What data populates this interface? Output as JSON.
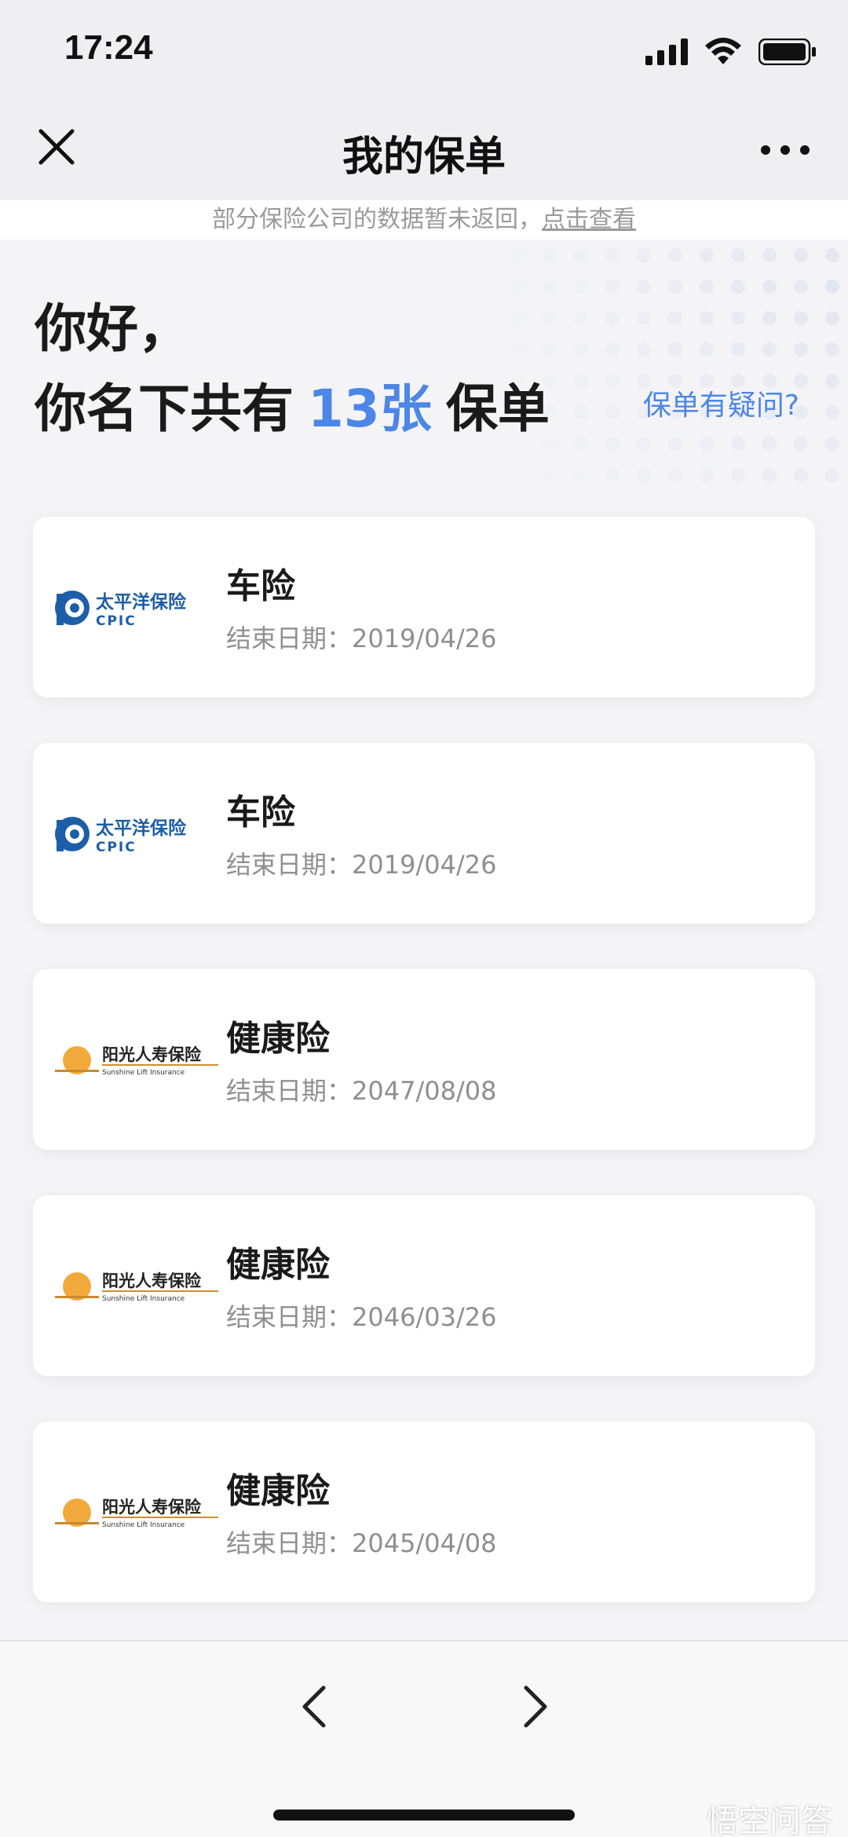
{
  "status_bar": {
    "time": "17:24",
    "icons": [
      "signal-icon",
      "wifi-icon",
      "battery-icon"
    ]
  },
  "nav": {
    "title": "我的保单",
    "close_icon": "close-icon",
    "more_icon": "more-icon"
  },
  "notice": {
    "text": "部分保险公司的数据暂未返回，",
    "link": "点击查看"
  },
  "greeting": {
    "hello": "你好，",
    "prefix": "你名下共有",
    "count": "13张",
    "suffix": "保单",
    "question_link": "保单有疑问?"
  },
  "policies": [
    {
      "title": "车险",
      "date_label": "结束日期：",
      "date": "2019/04/26",
      "insurer": "太平洋保险",
      "insurer_en": "CPIC"
    },
    {
      "title": "车险",
      "date_label": "结束日期：",
      "date": "2019/04/26",
      "insurer": "太平洋保险",
      "insurer_en": "CPIC"
    },
    {
      "title": "健康险",
      "date_label": "结束日期：",
      "date": "2047/08/08",
      "insurer": "阳光人寿保险",
      "insurer_en": "Sunshine Lift Insurance"
    },
    {
      "title": "健康险",
      "date_label": "结束日期：",
      "date": "2046/03/26",
      "insurer": "阳光人寿保险",
      "insurer_en": "Sunshine Lift Insurance"
    },
    {
      "title": "健康险",
      "date_label": "结束日期：",
      "date": "2045/04/08",
      "insurer": "阳光人寿保险",
      "insurer_en": "Sunshine Lift Insurance"
    }
  ],
  "toolbar": {
    "back_icon": "chevron-left-icon",
    "forward_icon": "chevron-right-icon"
  },
  "watermark": "悟空问答",
  "colors": {
    "accent": "#4c86e6",
    "cpic_blue": "#1d5ea8",
    "sunshine_orange": "#f2a93b"
  }
}
